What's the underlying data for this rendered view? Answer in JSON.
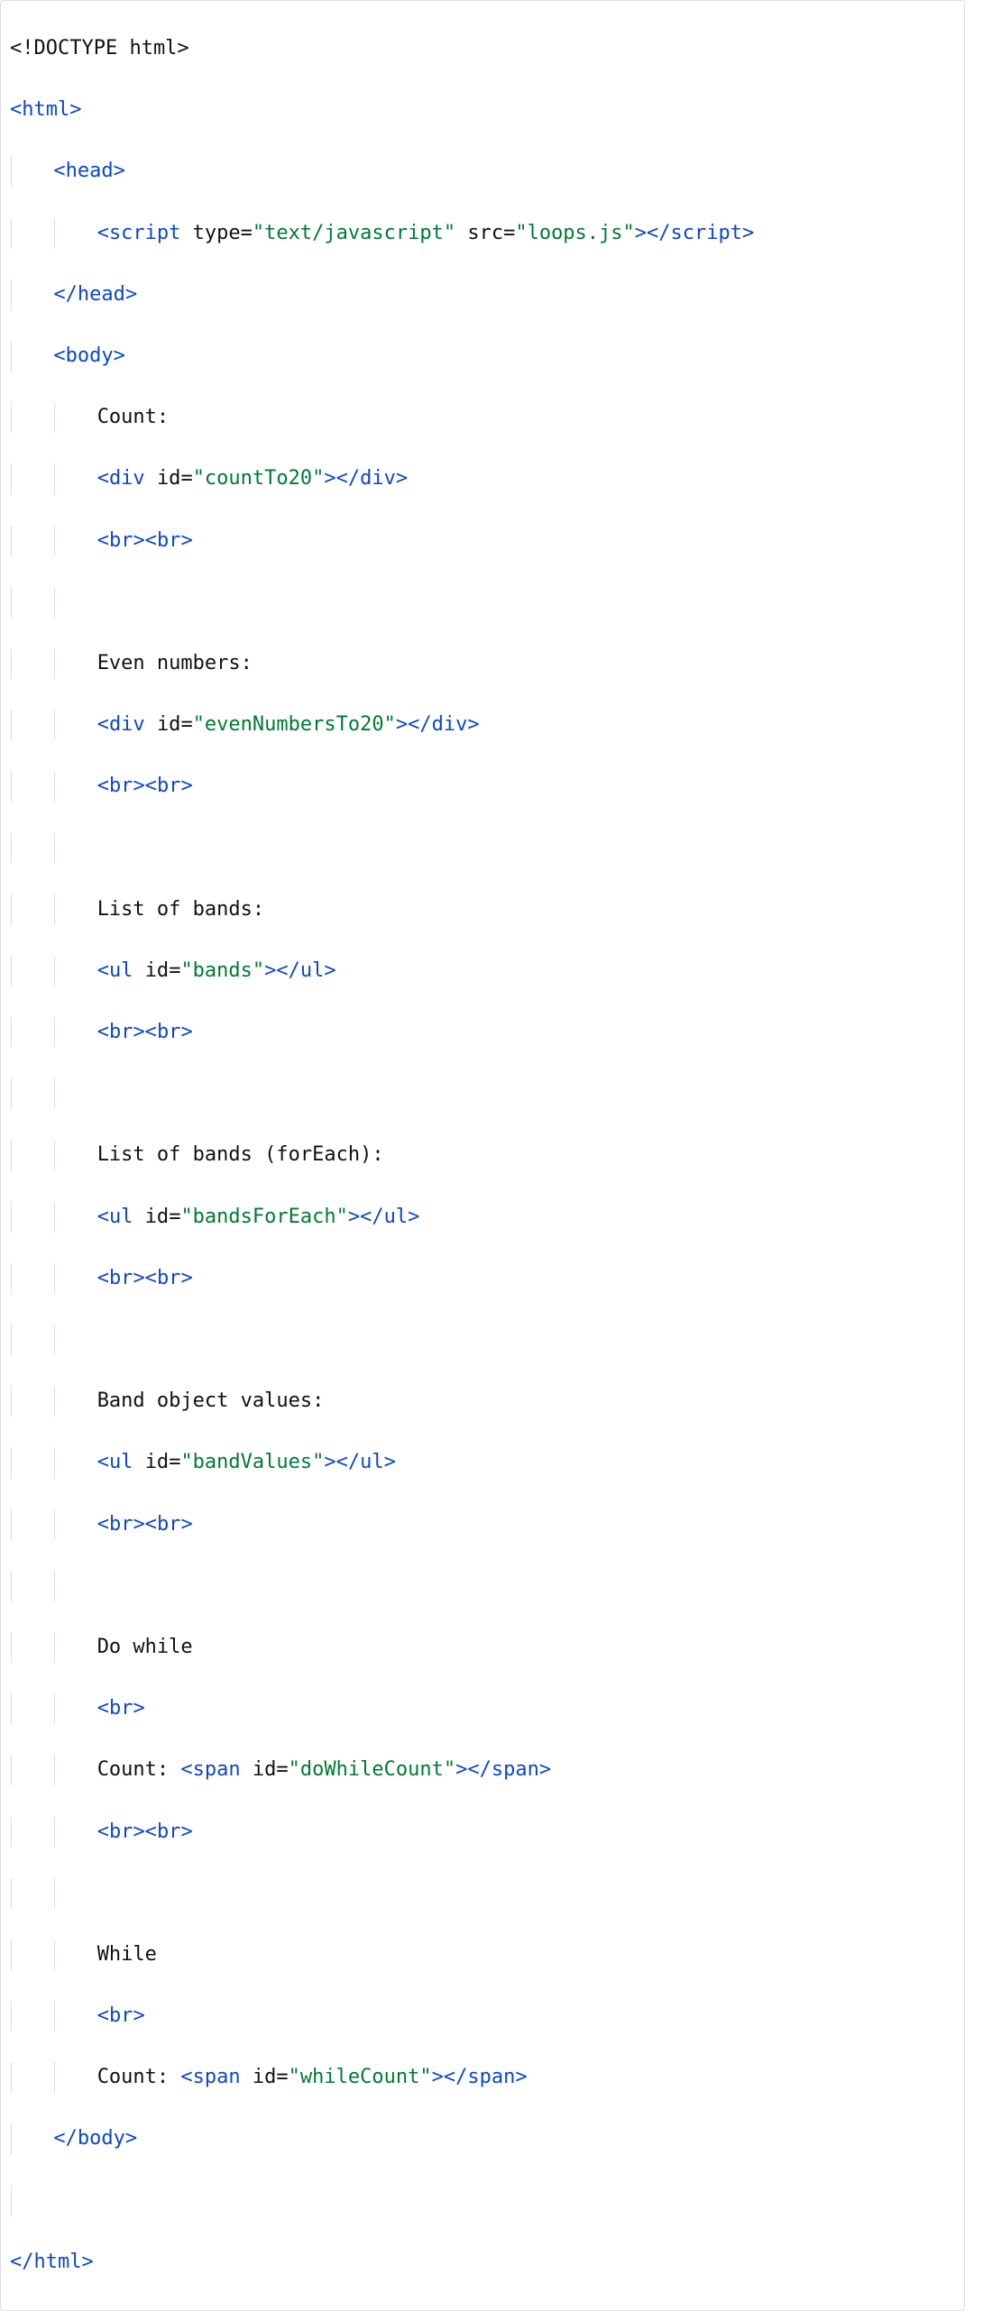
{
  "code": {
    "doctype": "<!DOCTYPE html>",
    "html_open": "html",
    "head_open": "head",
    "script_tag": "script",
    "script_type_attr": "type",
    "script_type_val": "\"text/javascript\"",
    "script_src_attr": "src",
    "script_src_val": "\"loops.js\"",
    "head_close": "head",
    "body_open": "body",
    "text_count": "Count:",
    "div_tag": "div",
    "id_attr": "id",
    "id_countTo20": "\"countTo20\"",
    "br_tag": "br",
    "text_even": "Even numbers:",
    "id_even": "\"evenNumbersTo20\"",
    "text_bands": "List of bands:",
    "ul_tag": "ul",
    "id_bands": "\"bands\"",
    "text_bands_foreach": "List of bands (forEach):",
    "id_bands_foreach": "\"bandsForEach\"",
    "text_band_values": "Band object values:",
    "id_band_values": "\"bandValues\"",
    "text_dowhile": "Do while",
    "text_count2": "Count: ",
    "span_tag": "span",
    "id_dowhile": "\"doWhileCount\"",
    "text_while": "While",
    "text_count3": "Count: ",
    "id_while": "\"whileCount\"",
    "body_close": "body",
    "html_close": "html"
  }
}
